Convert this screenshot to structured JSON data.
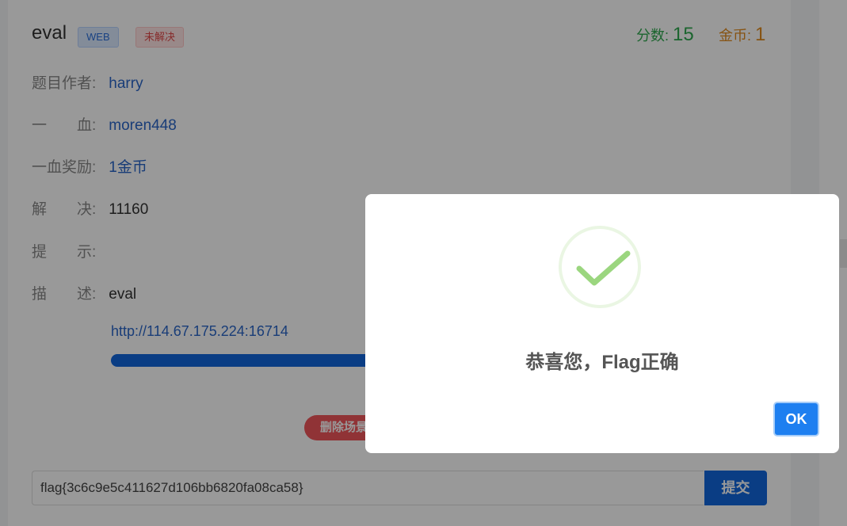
{
  "challenge": {
    "name": "eval",
    "category_tag": "WEB",
    "status_tag": "未解决",
    "points_label": "分数:",
    "points_value": "15",
    "coins_label": "金币:",
    "coins_value": "1"
  },
  "details": {
    "author_label": "题目作者:",
    "author_value": "harry",
    "first_blood_label": "一　　血:",
    "first_blood_value": "moren448",
    "first_blood_reward_label": "一血奖励:",
    "first_blood_reward_value": "1金币",
    "solves_label": "解　　决:",
    "solves_value": "11160",
    "hint_label": "提　　示:",
    "hint_value": "",
    "description_label": "描　　述:",
    "description_value": "eval"
  },
  "scene": {
    "url": "http://114.67.175.224:16714",
    "delete_button": "删除场景"
  },
  "flag_form": {
    "value": "flag{3c6c9e5c411627d106bb6820fa08ca58}",
    "submit_label": "提交"
  },
  "modal": {
    "title": "恭喜您，Flag正确",
    "ok_label": "OK",
    "icon": "check-circle-icon"
  },
  "colors": {
    "overlay": "rgba(0,0,0,0.4)",
    "primary": "#1166dd",
    "success": "#7cc96a",
    "points": "#2fa84f",
    "coins": "#e08a1e"
  }
}
